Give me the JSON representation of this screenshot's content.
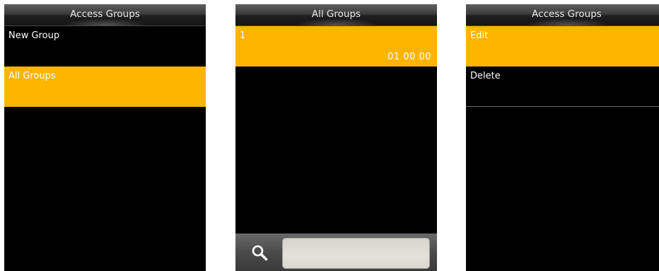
{
  "screens": [
    {
      "title": "Access Groups",
      "items": [
        {
          "label": "New Group"
        },
        {
          "label": "All Groups"
        }
      ]
    },
    {
      "title": "All Groups",
      "items": [
        {
          "label": "1",
          "value": "01 00 00"
        }
      ]
    },
    {
      "title": "Access Groups",
      "items": [
        {
          "label": "Edit"
        },
        {
          "label": "Delete"
        }
      ]
    }
  ],
  "colors": {
    "highlight": "#fdb500",
    "background": "#000000",
    "text": "#ffffff"
  },
  "icons": {
    "search": "search-icon"
  }
}
